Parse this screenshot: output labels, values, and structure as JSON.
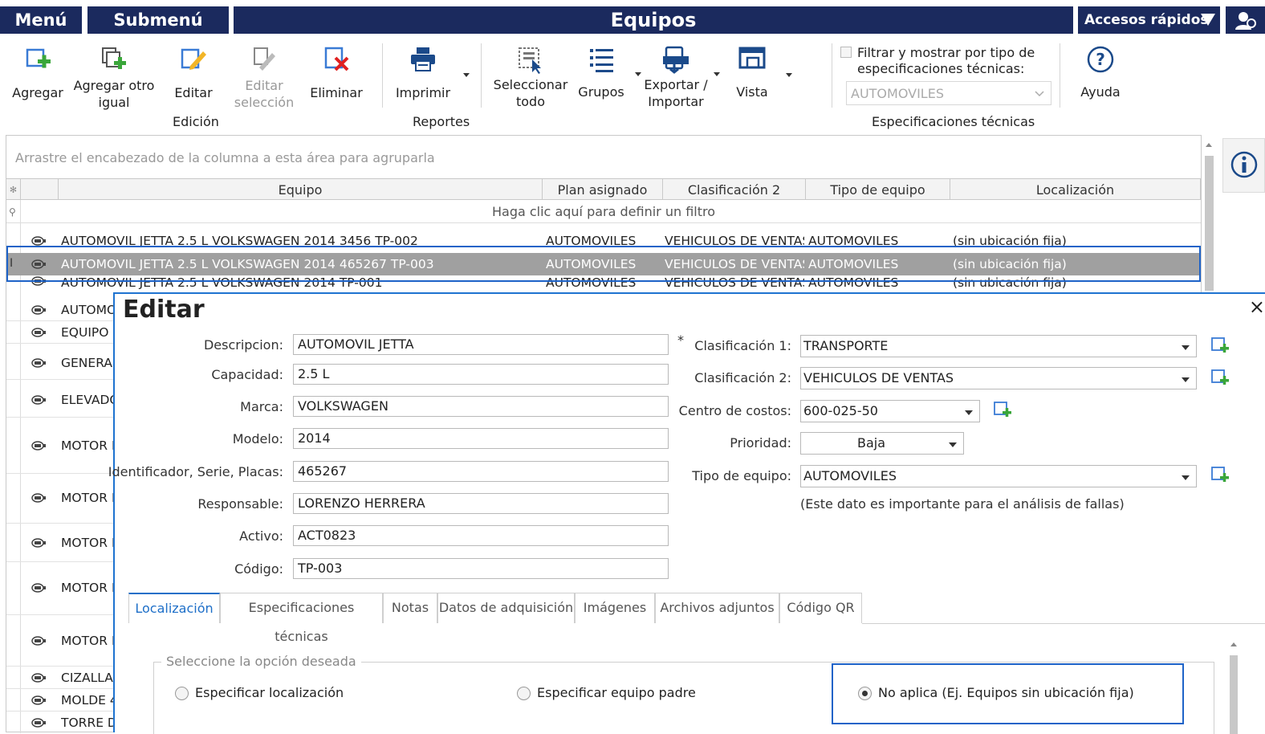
{
  "topbar": {
    "menu": "Menú",
    "submenu": "Submenú",
    "title": "Equipos",
    "accesos": "Accesos rápidos"
  },
  "ribbon": {
    "agregar": "Agregar",
    "agregar_otro_1": "Agregar otro",
    "agregar_otro_2": "igual",
    "editar": "Editar",
    "editar_sel_1": "Editar",
    "editar_sel_2": "selección",
    "eliminar": "Eliminar",
    "imprimir": "Imprimir",
    "seleccionar_1": "Seleccionar",
    "seleccionar_2": "todo",
    "grupos": "Grupos",
    "exportar_1": "Exportar /",
    "exportar_2": "Importar",
    "vista": "Vista",
    "filtrar_1": "Filtrar y mostrar por tipo de",
    "filtrar_2": "especificaciones técnicas:",
    "filtrar_value": "AUTOMOVILES",
    "ayuda": "Ayuda",
    "group_edicion": "Edición",
    "group_reportes": "Reportes",
    "group_espec": "Especificaciones técnicas"
  },
  "grid": {
    "group_hint": "Arrastre el encabezado de la columna a esta área para agruparla",
    "columns": [
      "Equipo",
      "Plan asignado",
      "Clasificación 2",
      "Tipo de equipo",
      "Localización"
    ],
    "filter_hint": "Haga clic aquí para definir un filtro",
    "rows": [
      [
        "AUTOMOVIL JETTA 2.5 L VOLKSWAGEN 2014 3456 TP-002",
        "AUTOMOVILES",
        "VEHICULOS DE VENTAS",
        "AUTOMOVILES",
        "(sin ubicación fija)"
      ],
      [
        "AUTOMOVIL JETTA 2.5 L VOLKSWAGEN 2014 465267 TP-003",
        "AUTOMOVILES",
        "VEHICULOS DE VENTAS",
        "AUTOMOVILES",
        "(sin ubicación fija)"
      ],
      [
        "AUTOMOVIL JETTA 2.5 L VOLKSWAGEN 2014 TP-001",
        "AUTOMOVILES",
        "VEHICULOS DE VENTAS",
        "AUTOMOVILES",
        "(sin ubicación fija)"
      ]
    ],
    "partial_rows": [
      "AUTOMO",
      "EQUIPO",
      "GENERAD",
      "ELEVADO",
      "MOTOR E",
      "MOTOR E",
      "MOTOR E",
      "MOTOR E",
      "MOTOR E",
      "CIZALLA",
      "MOLDE 4",
      "TORRE D"
    ]
  },
  "edit": {
    "title": "Editar",
    "close": "×",
    "descripcion_label": "Descripcion:",
    "descripcion": "AUTOMOVIL JETTA",
    "required_mark": "*",
    "capacidad_label": "Capacidad:",
    "capacidad": "2.5 L",
    "marca_label": "Marca:",
    "marca": "VOLKSWAGEN",
    "modelo_label": "Modelo:",
    "modelo": "2014",
    "identificador_label": "Identificador, Serie, Placas:",
    "identificador": "465267",
    "responsable_label": "Responsable:",
    "responsable": "LORENZO HERRERA",
    "activo_label": "Activo:",
    "activo": "ACT0823",
    "codigo_label": "Código:",
    "codigo": "TP-003",
    "clasif1_label": "Clasificación 1:",
    "clasif1": "TRANSPORTE",
    "clasif2_label": "Clasificación 2:",
    "clasif2": "VEHICULOS DE VENTAS",
    "centro_label": "Centro de costos:",
    "centro": "600-025-50",
    "prioridad_label": "Prioridad:",
    "prioridad": "Baja",
    "tipo_label": "Tipo de equipo:",
    "tipo": "AUTOMOVILES",
    "tipo_note": "(Este dato es importante para el análisis de fallas)",
    "tabs": [
      "Localización",
      "Especificaciones técnicas",
      "Notas",
      "Datos de adquisición",
      "Imágenes",
      "Archivos adjuntos",
      "Código QR"
    ],
    "legend": "Seleccione la opción deseada",
    "radio_1": "Especificar localización",
    "radio_2": "Especificar equipo padre",
    "radio_3": "No aplica (Ej. Equipos sin ubicación fija)"
  },
  "colors": {
    "navy": "#1b2a5e",
    "accent_blue": "#1e63c8",
    "selected_row": "#a0a0a0",
    "add_green": "#3aa63a",
    "delete_red": "#e02020"
  }
}
